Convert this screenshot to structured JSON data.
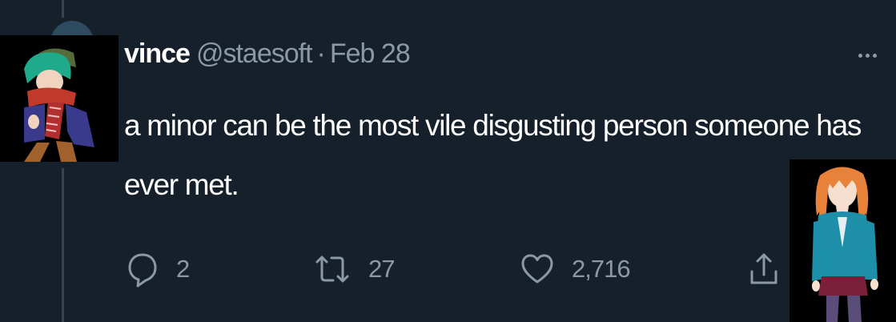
{
  "tweet": {
    "display_name": "vince",
    "handle": "@staesoft",
    "separator": "·",
    "date": "Feb 28",
    "text": "a minor can be the most vile disgusting person someone has ever met."
  },
  "actions": {
    "reply_count": "2",
    "retweet_count": "27",
    "like_count": "2,716"
  },
  "icons": {
    "more": "more-horizontal-icon",
    "reply": "reply-icon",
    "retweet": "retweet-icon",
    "like": "heart-icon",
    "share": "share-icon"
  },
  "colors": {
    "background": "#15202b",
    "text_primary": "#ffffff",
    "text_secondary": "#8b98a5",
    "thread_line": "#38444d"
  }
}
